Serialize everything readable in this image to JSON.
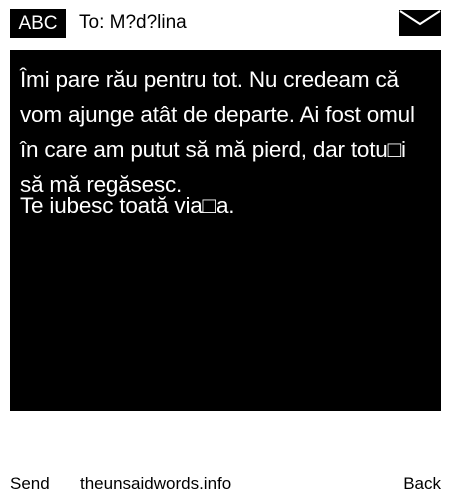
{
  "header": {
    "input_mode": "ABC",
    "to_label": "To: M?d?lina"
  },
  "message": {
    "lines": [
      "Îmi pare rău pentru tot. Nu credeam că vom ajunge atât de departe. Ai fost omul în care am putut să mă pierd, dar totu□i să mă regăsesc.",
      "Te iubesc toată via□a."
    ]
  },
  "footer": {
    "left_softkey": "Send",
    "center_link": "theunsaidwords.info",
    "right_softkey": "Back"
  }
}
